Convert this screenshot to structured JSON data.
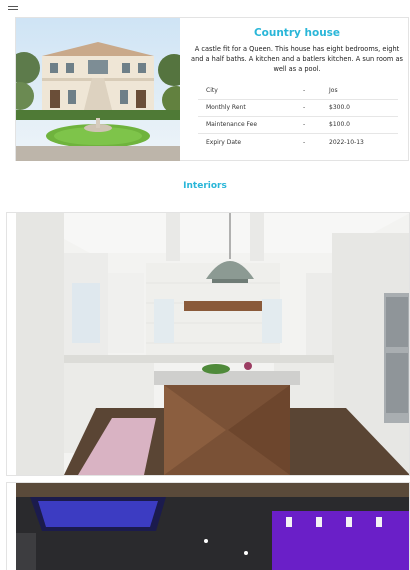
{
  "nav": {
    "menu_icon": "hamburger-icon"
  },
  "listing": {
    "title": "Country house",
    "description": "A castle fit for a Queen. This house has eight bedrooms, eight and a half baths. A kitchen and a batlers kitchen. A sun room as well as a pool.",
    "separator": "-",
    "details": [
      {
        "label": "City",
        "value": "Jos"
      },
      {
        "label": "Monthly Rent",
        "value": "$300.0"
      },
      {
        "label": "Maintenance Fee",
        "value": "$100.0"
      },
      {
        "label": "Expiry Date",
        "value": "2022-10-13"
      }
    ]
  },
  "interiors": {
    "heading": "Interiors"
  },
  "colors": {
    "accent": "#29b6d8",
    "border": "#e3e3e3"
  }
}
